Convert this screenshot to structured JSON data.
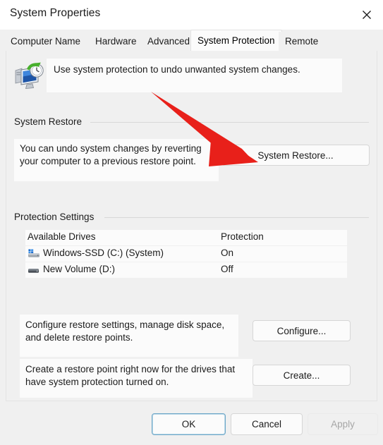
{
  "window": {
    "title": "System Properties",
    "close_icon": "close-icon"
  },
  "tabs": [
    {
      "label": "Computer Name",
      "selected": false
    },
    {
      "label": "Hardware",
      "selected": false
    },
    {
      "label": "Advanced",
      "selected": false
    },
    {
      "label": "System Protection",
      "selected": true
    },
    {
      "label": "Remote",
      "selected": false
    }
  ],
  "info": {
    "icon": "system-restore-icon",
    "text": "Use system protection to undo unwanted system changes."
  },
  "system_restore": {
    "group_label": "System Restore",
    "description_line1": "You can undo system changes by reverting",
    "description_line2": "your computer to a previous restore point.",
    "button_label": "System Restore..."
  },
  "protection_settings": {
    "group_label": "Protection Settings",
    "columns": [
      "Available Drives",
      "Protection"
    ],
    "rows": [
      {
        "icon": "windows-drive-icon",
        "drive": "Windows-SSD (C:) (System)",
        "protection": "On"
      },
      {
        "icon": "hard-drive-icon",
        "drive": "New Volume (D:)",
        "protection": "Off"
      }
    ]
  },
  "configure_row": {
    "description_line1": "Configure restore settings, manage disk space,",
    "description_line2": "and delete restore points.",
    "button_label": "Configure..."
  },
  "create_row": {
    "description_line1": "Create a restore point right now for the drives that",
    "description_line2": "have system protection turned on.",
    "button_label": "Create..."
  },
  "footer": {
    "ok_label": "OK",
    "cancel_label": "Cancel",
    "apply_label": "Apply",
    "apply_disabled": true
  },
  "annotation": {
    "type": "arrow",
    "color": "#e8201a",
    "points_to": "system-restore-button"
  },
  "colors": {
    "dialog_background": "#f0f0f0",
    "panel_background": "#fbfbfb",
    "text": "#1b1b1b",
    "disabled_text": "#a6a6a6",
    "default_button_border": "#6da7c8",
    "annotation_red": "#e8201a"
  }
}
